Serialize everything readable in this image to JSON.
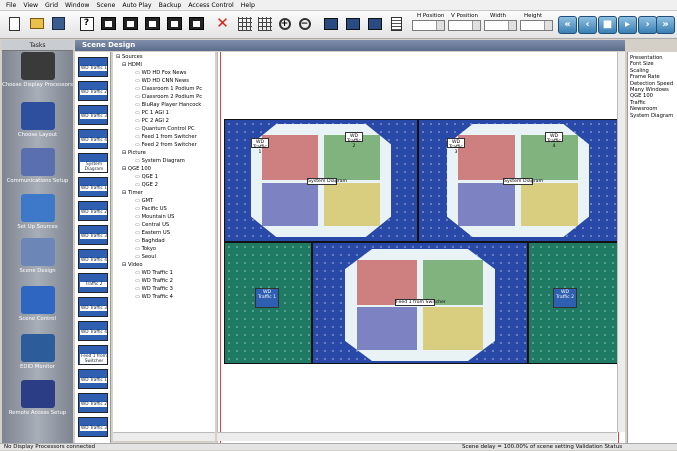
{
  "menu": [
    "File",
    "View",
    "Grid",
    "Window",
    "Scene",
    "Auto Play",
    "Backup",
    "Access Control",
    "Help"
  ],
  "toolbar": {
    "h_position": "H Position",
    "v_position": "V Position",
    "width": "Width",
    "height": "Height"
  },
  "tasks": {
    "title": "Tasks",
    "items": [
      {
        "label": "Choose Display Processors",
        "icon": "rack-icon",
        "color": "#3a3a3a"
      },
      {
        "label": "Choose Layout",
        "icon": "layout-icon",
        "color": "#2d4f9e"
      },
      {
        "label": "Communications Setup",
        "icon": "plug-icon",
        "color": "#5a6fb0"
      },
      {
        "label": "Set Up Sources",
        "icon": "laptop-icon",
        "color": "#3e78c8"
      },
      {
        "label": "Scene Design",
        "icon": "palette-icon",
        "color": "#6d86b8"
      },
      {
        "label": "Scene Control",
        "icon": "wall-icon",
        "color": "#2e66c2"
      },
      {
        "label": "EDID Monitor",
        "icon": "monitor-icon",
        "color": "#2c5d9a"
      },
      {
        "label": "Remote Access Setup",
        "icon": "compass-icon",
        "color": "#2b3e85"
      }
    ]
  },
  "panel": {
    "title": "Scene Design"
  },
  "thumbnails": [
    "WD Traffic 1",
    "WD Traffic 2",
    "WD Traffic 3",
    "WD Traffic 4",
    "System Diagram",
    "WD Traffic 1",
    "WD Traffic 2",
    "WD Traffic 3",
    "WD Traffic 4",
    "Traffic 2",
    "WD Traffic 3",
    "WD Traffic 4",
    "Feed 1 from Switcher",
    "WD Traffic 1",
    "WD Traffic 2",
    "WD Traffic 3"
  ],
  "tree": {
    "root": "Sources",
    "groups": [
      {
        "name": "HDMI",
        "items": [
          "WD HD Fox News",
          "WD HD CNN News",
          "Classroom 1 Podium Pc",
          "Classroom 2 Podium Pc",
          "BluRay Player Hancock",
          "PC 1 AGI 1",
          "PC 2 AGI 2",
          "Quantum Control PC",
          "Feed 1 from Switcher",
          "Feed 2 from Switcher"
        ]
      },
      {
        "name": "Picture",
        "items": [
          "System Diagram"
        ]
      },
      {
        "name": "QGE 100",
        "items": [
          "QGE 1",
          "QGE 2"
        ]
      },
      {
        "name": "Timer",
        "items": [
          "GMT",
          "Pacific US",
          "Mountain US",
          "Central US",
          "Eastern US",
          "Baghdad",
          "Tokyo",
          "Seoul"
        ]
      },
      {
        "name": "Video",
        "items": [
          "WD Traffic 1",
          "WD Traffic 2",
          "WD Traffic 3",
          "WD Traffic 4"
        ]
      }
    ]
  },
  "canvas": {
    "diagram_label_1": "System Diagram",
    "diagram_label_2": "System Diagram",
    "diagram_label_3": "Feed 1 from Switcher",
    "small_windows": [
      "WD Traffic 1",
      "WD Traffic 2",
      "WD Traffic 3",
      "WD Traffic 4",
      "WD Traffic 1",
      "WD Traffic 2"
    ]
  },
  "properties": [
    "Presentation",
    "Font Size",
    "Scaling",
    "Frame Rate",
    "Detection Speed",
    "Many Windows",
    "QGE 100",
    "Traffic",
    "Newsroom",
    "System Diagram"
  ],
  "status": {
    "left": "No Display Processors connected",
    "right": "Scene delay = 100.00% of scene setting Validation Status"
  }
}
